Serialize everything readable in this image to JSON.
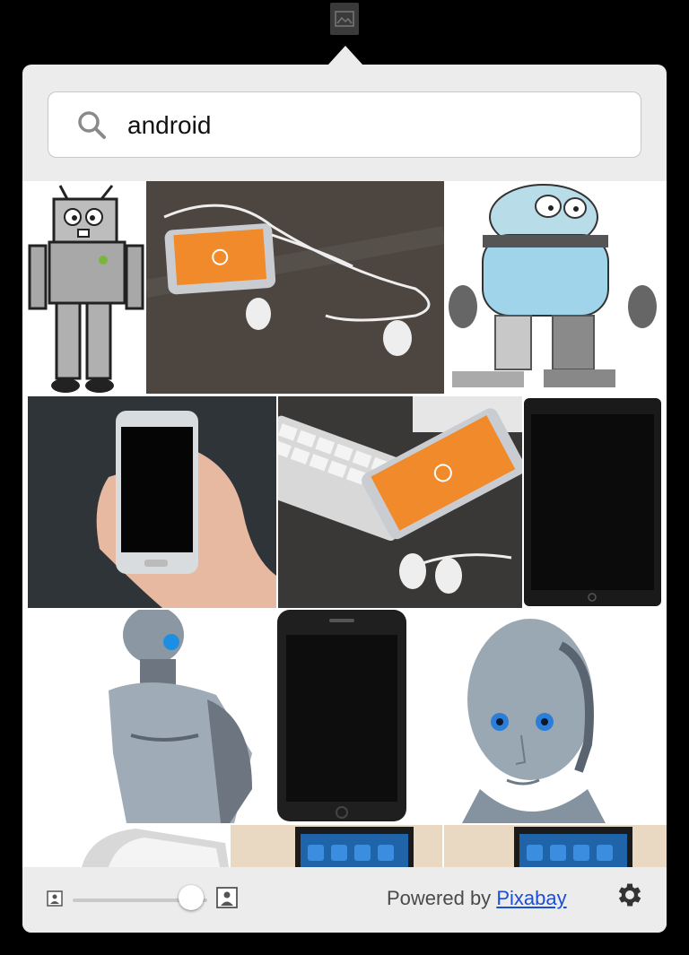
{
  "search": {
    "value": "android"
  },
  "images": [
    {
      "name": "cartoon-robot-gray",
      "subject": "robot"
    },
    {
      "name": "smartphone-with-earphones",
      "subject": "phone"
    },
    {
      "name": "cartoon-robot-blue",
      "subject": "robot"
    },
    {
      "name": "hand-holding-smartphone",
      "subject": "phone"
    },
    {
      "name": "phone-keyboard-earphones",
      "subject": "phone"
    },
    {
      "name": "black-tablet",
      "subject": "tablet"
    },
    {
      "name": "silver-cyborg-torso",
      "subject": "robot"
    },
    {
      "name": "black-smartphone",
      "subject": "phone"
    },
    {
      "name": "silver-android-head",
      "subject": "robot"
    },
    {
      "name": "white-phone-partial",
      "subject": "phone"
    },
    {
      "name": "tablet-app-icons-1",
      "subject": "tablet"
    },
    {
      "name": "tablet-app-icons-2",
      "subject": "tablet"
    }
  ],
  "footer": {
    "powered_by": "Powered by",
    "link": "Pixabay",
    "thumbnail_size": 0.88
  },
  "icons": {
    "menubar": "image-picker-icon",
    "search": "search-icon",
    "size_small": "small-image-icon",
    "size_large": "large-image-icon",
    "settings": "gear-icon"
  },
  "colors": {
    "popover_bg": "#ececec",
    "link": "#1a4fd6",
    "accent_orange": "#f08a2a"
  }
}
